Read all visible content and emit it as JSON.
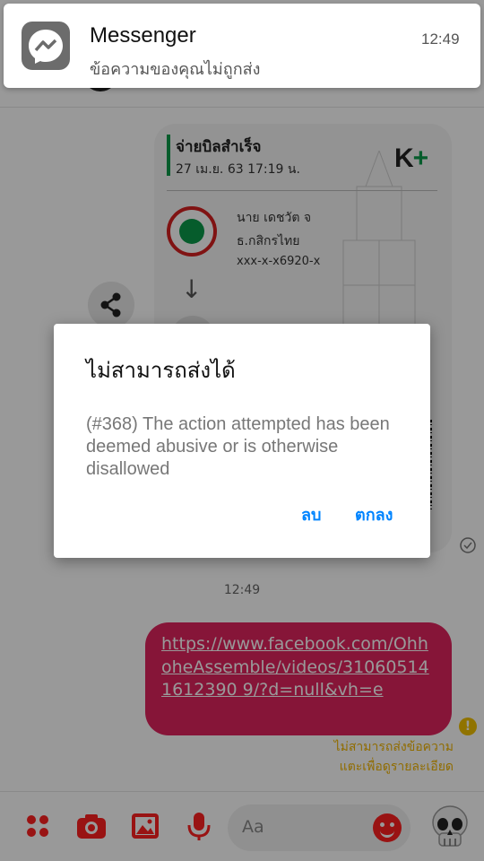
{
  "notification": {
    "app_name": "Messenger",
    "time": "12:49",
    "message": "ข้อความของคุณไม่ถูกส่ง"
  },
  "receipt": {
    "title": "จ่ายบิลสำเร็จ",
    "datetime": "27 เม.ย. 63  17:19 น.",
    "brand_k": "K",
    "brand_plus": "+",
    "payer_name": "นาย เดชวัต จ",
    "payer_bank": "ธ.กสิกรไทย",
    "payer_account": "xxx-x-x6920-x"
  },
  "chat": {
    "time_divider": "12:49",
    "message_link": "https://www.facebook.com/OhhoheAssemble/videos/310605141612390 9/?d=null&vh=e",
    "error_text_line1": "ไม่สามารถส่งข้อความ",
    "error_text_line2": "แตะเพื่อดูรายละเอียด"
  },
  "composer": {
    "placeholder": "Aa"
  },
  "dialog": {
    "title": "ไม่สามารถส่งได้",
    "message": "(#368) The action attempted has been deemed abusive or is otherwise disallowed",
    "delete_label": "ลบ",
    "ok_label": "ตกลง"
  },
  "colors": {
    "accent_blue": "#0084ff",
    "message_bubble": "#e0245e",
    "error_yellow": "#f0b400",
    "composer_red": "#ff2020"
  },
  "icons": [
    "messenger-icon",
    "share-icon",
    "check-circle-icon",
    "error-icon",
    "apps-icon",
    "camera-icon",
    "gallery-icon",
    "microphone-icon",
    "emoji-icon",
    "skull-icon",
    "info-icon"
  ]
}
